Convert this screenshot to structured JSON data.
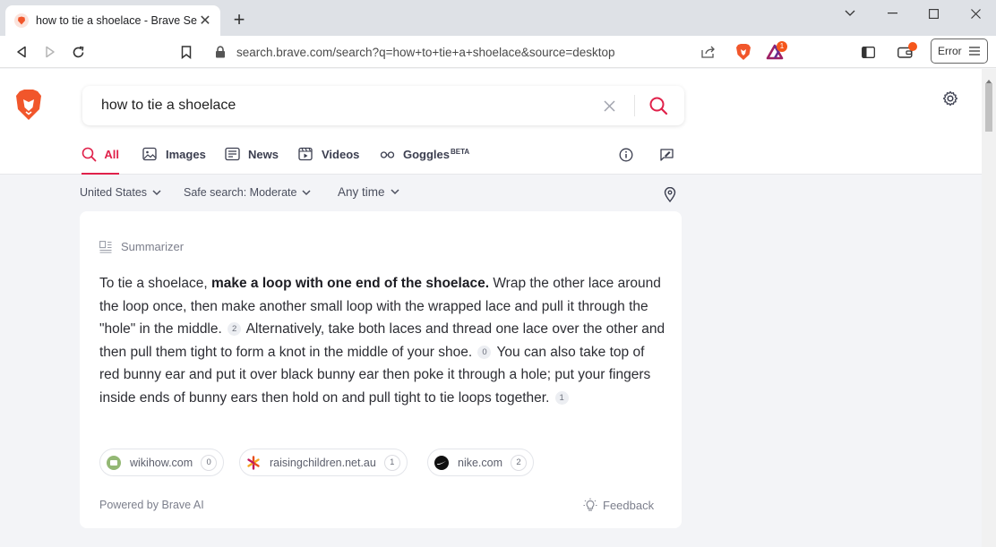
{
  "tab": {
    "title": "how to tie a shoelace - Brave Search",
    "favicon": "brave-lion-icon"
  },
  "address_bar": {
    "url": "search.brave.com/search?q=how+to+tie+a+shoelace&source=desktop"
  },
  "toolbar": {
    "error_label": "Error",
    "rewards_badge": "1"
  },
  "search": {
    "query": "how to tie a shoelace"
  },
  "nav_tabs": [
    {
      "label": "All",
      "icon": "search-icon",
      "active": true
    },
    {
      "label": "Images",
      "icon": "image-icon"
    },
    {
      "label": "News",
      "icon": "news-icon"
    },
    {
      "label": "Videos",
      "icon": "video-icon"
    },
    {
      "label": "Goggles",
      "sup": "BETA",
      "icon": "goggles-icon"
    }
  ],
  "filters": {
    "region": "United States",
    "safe_search": "Safe search: Moderate",
    "time": "Any time"
  },
  "summarizer": {
    "label": "Summarizer",
    "p1": "To tie a shoelace, ",
    "p1_bold": "make a loop with one end of the shoelace.",
    "p2": " Wrap the other lace around the loop once, then make another small loop with the wrapped lace and pull it through the \"hole\" in the middle.",
    "cite_a": "2",
    "p3": " Alternatively, take both laces and thread one lace over the other and then pull them tight to form a knot in the middle of your shoe.",
    "cite_b": "0",
    "p4": " You can also take top of red bunny ear and put it over black bunny ear then poke it through a hole; put your fingers inside ends of bunny ears then hold on and pull tight to tie loops together.",
    "cite_c": "1",
    "sources": [
      {
        "domain": "wikihow.com",
        "num": "0"
      },
      {
        "domain": "raisingchildren.net.au",
        "num": "1"
      },
      {
        "domain": "nike.com",
        "num": "2"
      }
    ],
    "powered_by": "Powered by Brave AI",
    "feedback": "Feedback"
  },
  "colors": {
    "accent": "#e0214a",
    "brave_orange": "#f5561b",
    "page_bg": "#f3f4f7"
  }
}
